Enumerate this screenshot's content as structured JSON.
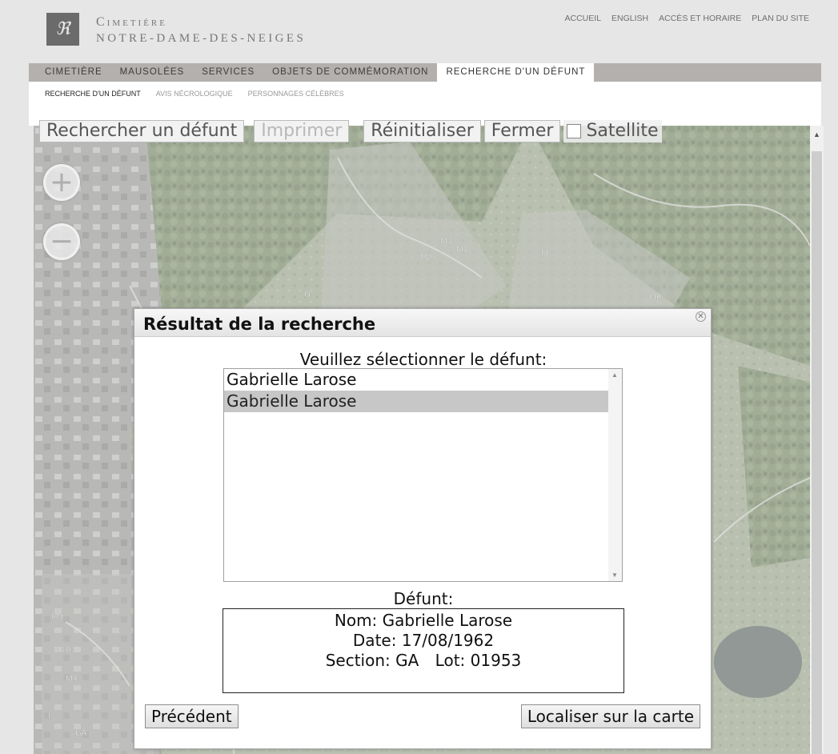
{
  "header": {
    "logo_glyph": "ℜ",
    "brand_line1": "Cimetière",
    "brand_line2": "NOTRE-DAME-DES-NEIGES",
    "top_links": [
      "ACCUEIL",
      "ENGLISH",
      "ACCÈS ET HORAIRE",
      "PLAN DU SITE"
    ]
  },
  "mainnav": {
    "items": [
      "CIMETIÈRE",
      "MAUSOLÉES",
      "SERVICES",
      "OBJETS DE COMMÉMORATION",
      "RECHERCHE D'UN DÉFUNT"
    ],
    "active": "RECHERCHE D'UN DÉFUNT"
  },
  "subnav": {
    "items": [
      "RECHERCHE D'UN DÉFUNT",
      "AVIS NÉCROLOGIQUE",
      "PERSONNAGES CÉLÈBRES"
    ],
    "active": "RECHERCHE D'UN DÉFUNT"
  },
  "map_toolbar": {
    "search_label": "Rechercher un défunt",
    "print_label": "Imprimer",
    "reset_label": "Réinitialiser",
    "close_label": "Fermer",
    "satellite_label": "Satellite",
    "satellite_checked": false
  },
  "map": {
    "zoom_in": "+",
    "zoom_out": "−",
    "section_labels": [
      "M3",
      "M1",
      "M2",
      "M",
      "O",
      "OR",
      "M9",
      "M10",
      "M4",
      "I",
      "GA"
    ]
  },
  "dialog": {
    "title": "Résultat de la recherche",
    "prompt": "Veuillez sélectionner le défunt:",
    "results": [
      "Gabrielle Larose",
      "Gabrielle Larose"
    ],
    "selected_index": 1,
    "defunt_label": "Défunt:",
    "details": {
      "nom_label": "Nom:",
      "nom": "Gabrielle Larose",
      "date_label": "Date:",
      "date": "17/08/1962",
      "section_label": "Section:",
      "section": "GA",
      "lot_label": "Lot:",
      "lot": "01953"
    },
    "prev_button": "Précédent",
    "locate_button": "Localiser sur la carte"
  }
}
